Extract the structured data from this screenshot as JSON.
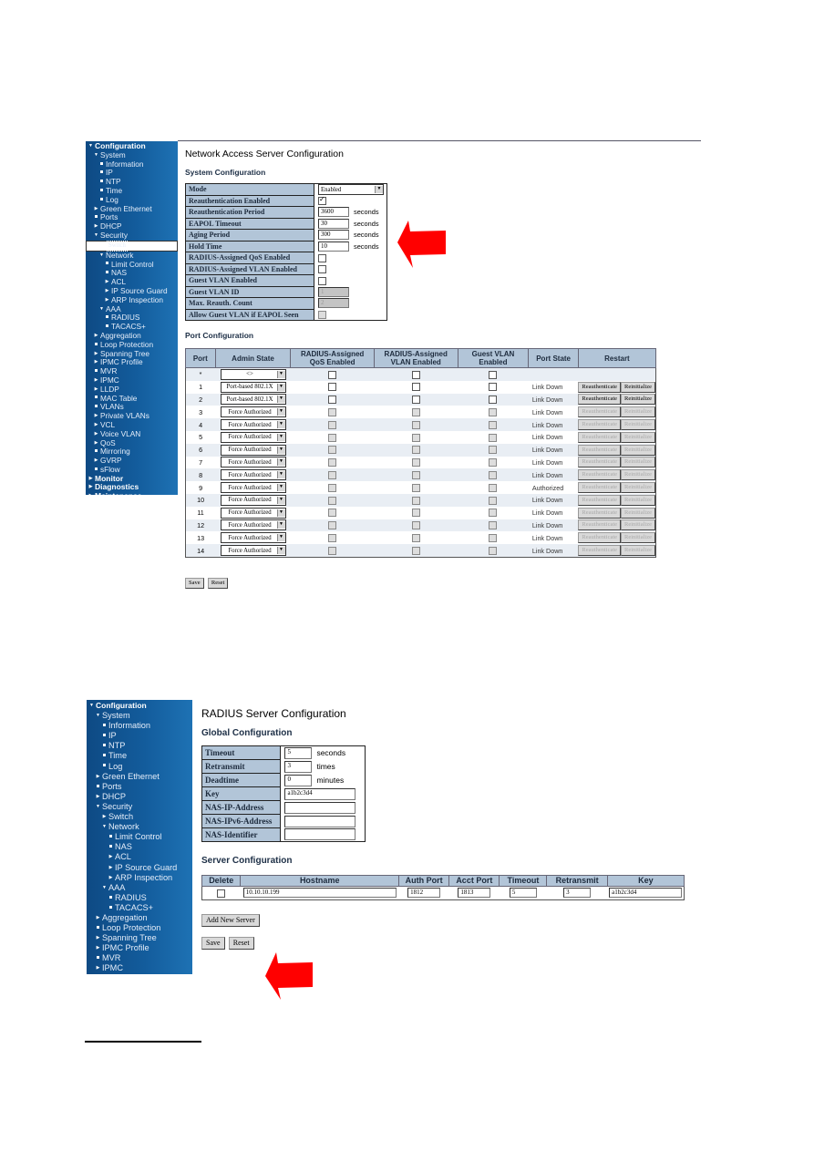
{
  "nav_tree": [
    {
      "label": "Configuration",
      "level": 0,
      "marker": "down",
      "top": true
    },
    {
      "label": "System",
      "level": 1,
      "marker": "down"
    },
    {
      "label": "Information",
      "level": 2,
      "marker": "dot"
    },
    {
      "label": "IP",
      "level": 2,
      "marker": "dot"
    },
    {
      "label": "NTP",
      "level": 2,
      "marker": "dot"
    },
    {
      "label": "Time",
      "level": 2,
      "marker": "dot"
    },
    {
      "label": "Log",
      "level": 2,
      "marker": "dot"
    },
    {
      "label": "Green Ethernet",
      "level": 1,
      "marker": "tri"
    },
    {
      "label": "Ports",
      "level": 1,
      "marker": "dot"
    },
    {
      "label": "DHCP",
      "level": 1,
      "marker": "tri"
    },
    {
      "label": "Security",
      "level": 1,
      "marker": "down"
    },
    {
      "label": "Switch",
      "level": 2,
      "marker": "tri"
    },
    {
      "label": "Network",
      "level": 2,
      "marker": "down"
    },
    {
      "label": "Limit Control",
      "level": 3,
      "marker": "dot"
    },
    {
      "label": "NAS",
      "level": 3,
      "marker": "dot"
    },
    {
      "label": "ACL",
      "level": 3,
      "marker": "tri"
    },
    {
      "label": "IP Source Guard",
      "level": 3,
      "marker": "tri"
    },
    {
      "label": "ARP Inspection",
      "level": 3,
      "marker": "tri"
    },
    {
      "label": "AAA",
      "level": 2,
      "marker": "down"
    },
    {
      "label": "RADIUS",
      "level": 3,
      "marker": "dot"
    },
    {
      "label": "TACACS+",
      "level": 3,
      "marker": "dot"
    },
    {
      "label": "Aggregation",
      "level": 1,
      "marker": "tri"
    },
    {
      "label": "Loop Protection",
      "level": 1,
      "marker": "dot"
    },
    {
      "label": "Spanning Tree",
      "level": 1,
      "marker": "tri"
    },
    {
      "label": "IPMC Profile",
      "level": 1,
      "marker": "tri"
    },
    {
      "label": "MVR",
      "level": 1,
      "marker": "dot"
    },
    {
      "label": "IPMC",
      "level": 1,
      "marker": "tri"
    },
    {
      "label": "LLDP",
      "level": 1,
      "marker": "tri"
    },
    {
      "label": "MAC Table",
      "level": 1,
      "marker": "dot"
    },
    {
      "label": "VLANs",
      "level": 1,
      "marker": "dot"
    },
    {
      "label": "Private VLANs",
      "level": 1,
      "marker": "tri"
    },
    {
      "label": "VCL",
      "level": 1,
      "marker": "tri"
    },
    {
      "label": "Voice VLAN",
      "level": 1,
      "marker": "tri"
    },
    {
      "label": "QoS",
      "level": 1,
      "marker": "tri"
    },
    {
      "label": "Mirroring",
      "level": 1,
      "marker": "dot"
    },
    {
      "label": "GVRP",
      "level": 1,
      "marker": "tri"
    },
    {
      "label": "sFlow",
      "level": 1,
      "marker": "dot"
    },
    {
      "label": "Monitor",
      "level": 0,
      "marker": "tri",
      "top": true
    },
    {
      "label": "Diagnostics",
      "level": 0,
      "marker": "tri",
      "top": true
    },
    {
      "label": "Maintenance",
      "level": 0,
      "marker": "tri",
      "top": true
    }
  ],
  "nas": {
    "page_title": "Network Access Server Configuration",
    "system_title": "System Configuration",
    "system_rows": [
      {
        "label": "Mode",
        "type": "select",
        "value": "Enabled"
      },
      {
        "label": "Reauthentication Enabled",
        "type": "checkbox",
        "checked": true
      },
      {
        "label": "Reauthentication Period",
        "type": "input",
        "value": "3600",
        "unit": "seconds"
      },
      {
        "label": "EAPOL Timeout",
        "type": "input",
        "value": "30",
        "unit": "seconds"
      },
      {
        "label": "Aging Period",
        "type": "input",
        "value": "300",
        "unit": "seconds"
      },
      {
        "label": "Hold Time",
        "type": "input",
        "value": "10",
        "unit": "seconds"
      },
      {
        "label": "RADIUS-Assigned QoS Enabled",
        "type": "checkbox",
        "checked": false
      },
      {
        "label": "RADIUS-Assigned VLAN Enabled",
        "type": "checkbox",
        "checked": false
      },
      {
        "label": "Guest VLAN Enabled",
        "type": "checkbox",
        "checked": false
      },
      {
        "label": "Guest VLAN ID",
        "type": "input-disabled",
        "value": "1"
      },
      {
        "label": "Max. Reauth. Count",
        "type": "input-disabled",
        "value": "2"
      },
      {
        "label": "Allow Guest VLAN if EAPOL Seen",
        "type": "checkbox-disabled",
        "checked": false
      }
    ],
    "port_title": "Port Configuration",
    "port_headers": [
      "Port",
      "Admin State",
      "RADIUS-Assigned QoS Enabled",
      "RADIUS-Assigned VLAN Enabled",
      "Guest VLAN Enabled",
      "Port State",
      "Restart"
    ],
    "reauth_label": "Reauthenticate",
    "reinit_label": "Reinitialize",
    "ports": [
      {
        "port": "*",
        "admin": "<>",
        "state": "",
        "enabled": true,
        "wildcard": true
      },
      {
        "port": "1",
        "admin": "Port-based 802.1X",
        "state": "Link Down",
        "enabled": true
      },
      {
        "port": "2",
        "admin": "Port-based 802.1X",
        "state": "Link Down",
        "enabled": true
      },
      {
        "port": "3",
        "admin": "Force Authorized",
        "state": "Link Down",
        "enabled": false
      },
      {
        "port": "4",
        "admin": "Force Authorized",
        "state": "Link Down",
        "enabled": false
      },
      {
        "port": "5",
        "admin": "Force Authorized",
        "state": "Link Down",
        "enabled": false
      },
      {
        "port": "6",
        "admin": "Force Authorized",
        "state": "Link Down",
        "enabled": false
      },
      {
        "port": "7",
        "admin": "Force Authorized",
        "state": "Link Down",
        "enabled": false
      },
      {
        "port": "8",
        "admin": "Force Authorized",
        "state": "Link Down",
        "enabled": false
      },
      {
        "port": "9",
        "admin": "Force Authorized",
        "state": "Authorized",
        "enabled": false
      },
      {
        "port": "10",
        "admin": "Force Authorized",
        "state": "Link Down",
        "enabled": false
      },
      {
        "port": "11",
        "admin": "Force Authorized",
        "state": "Link Down",
        "enabled": false
      },
      {
        "port": "12",
        "admin": "Force Authorized",
        "state": "Link Down",
        "enabled": false
      },
      {
        "port": "13",
        "admin": "Force Authorized",
        "state": "Link Down",
        "enabled": false
      },
      {
        "port": "14",
        "admin": "Force Authorized",
        "state": "Link Down",
        "enabled": false
      }
    ],
    "save_label": "Save",
    "reset_label": "Reset"
  },
  "radius": {
    "page_title": "RADIUS Server Configuration",
    "global_title": "Global Configuration",
    "global_rows": [
      {
        "label": "Timeout",
        "value": "5",
        "unit": "seconds",
        "short": true
      },
      {
        "label": "Retransmit",
        "value": "3",
        "unit": "times",
        "short": true
      },
      {
        "label": "Deadtime",
        "value": "0",
        "unit": "minutes",
        "short": true
      },
      {
        "label": "Key",
        "value": "a1b2c3d4",
        "unit": "",
        "short": false
      },
      {
        "label": "NAS-IP-Address",
        "value": "",
        "unit": "",
        "short": false
      },
      {
        "label": "NAS-IPv6-Address",
        "value": "",
        "unit": "",
        "short": false
      },
      {
        "label": "NAS-Identifier",
        "value": "",
        "unit": "",
        "short": false
      }
    ],
    "server_title": "Server Configuration",
    "server_headers": [
      "Delete",
      "Hostname",
      "Auth Port",
      "Acct Port",
      "Timeout",
      "Retransmit",
      "Key"
    ],
    "servers": [
      {
        "delete": false,
        "hostname": "10.10.10.199",
        "auth_port": "1812",
        "acct_port": "1813",
        "timeout": "5",
        "retransmit": "3",
        "key": "a1b2c3d4"
      }
    ],
    "add_server_label": "Add New Server",
    "save_label": "Save",
    "reset_label": "Reset"
  },
  "annotation_color": "#ff0000"
}
